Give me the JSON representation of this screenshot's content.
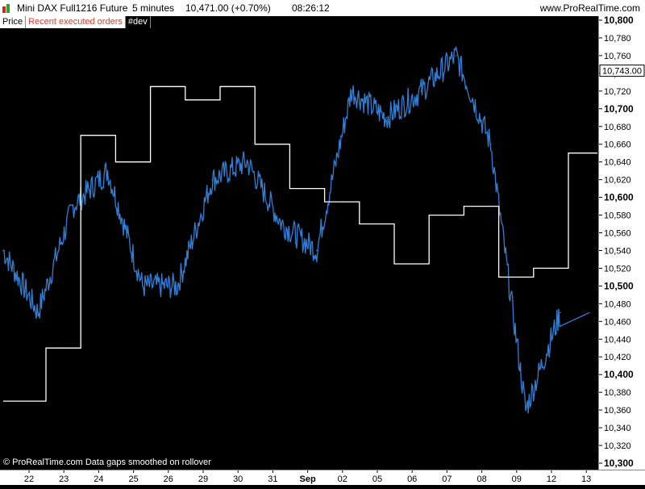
{
  "title_bar": {
    "instrument": "Mini DAX Full1216 Future",
    "timeframe": "5 minutes",
    "last_price": "10,471.00 (+0.70%)",
    "clock": "08:26:12",
    "site": "www.ProRealTime.com"
  },
  "legend": {
    "price": "Price",
    "orders": "Recent executed orders",
    "indicator": "#dev"
  },
  "footer": {
    "copyright": "© ProRealTime.com  Data gaps smoothed on rollover"
  },
  "price_marker": "10,743.00",
  "colors": {
    "price_series": "#2f7fd6",
    "indicator_series": "#ffffff",
    "orders_label": "#e03c2c",
    "background": "#000000"
  },
  "chart_data": {
    "type": "line",
    "y_tick_labels": [
      "10,800",
      "10,780",
      "10,760",
      "10,740",
      "10,720",
      "10,700",
      "10,680",
      "10,660",
      "10,640",
      "10,620",
      "10,600",
      "10,580",
      "10,560",
      "10,540",
      "10,520",
      "10,500",
      "10,480",
      "10,460",
      "10,440",
      "10,420",
      "10,400",
      "10,380",
      "10,360",
      "10,340",
      "10,320",
      "10,300"
    ],
    "bold_y_ticks": [
      "10,800",
      "10,700",
      "10,600",
      "10,500",
      "10,400",
      "10,300"
    ],
    "ylim": [
      10300,
      10800
    ],
    "x_tick_labels": [
      "22",
      "23",
      "24",
      "25",
      "26",
      "29",
      "30",
      "31",
      "Sep",
      "02",
      "05",
      "06",
      "07",
      "08",
      "09",
      "12",
      "13"
    ],
    "series": [
      {
        "name": "Price",
        "x": [
          "22",
          "23",
          "24",
          "25",
          "26",
          "29",
          "30",
          "31",
          "Sep",
          "02",
          "05",
          "06",
          "07",
          "08",
          "09",
          "12",
          "13"
        ],
        "values": [
          10540,
          10470,
          10590,
          10630,
          10500,
          10500,
          10620,
          10640,
          10570,
          10540,
          10720,
          10690,
          10720,
          10760,
          10660,
          10360,
          10470
        ]
      },
      {
        "name": "#dev",
        "x": [
          "22",
          "23",
          "24",
          "25",
          "26",
          "29",
          "30",
          "31",
          "Sep",
          "02",
          "05",
          "06",
          "07",
          "08",
          "09",
          "12",
          "13"
        ],
        "values": [
          10370,
          10430,
          10670,
          10640,
          10725,
          10710,
          10725,
          10660,
          10610,
          10595,
          10570,
          10525,
          10580,
          10590,
          10510,
          10520,
          10650
        ]
      }
    ]
  }
}
